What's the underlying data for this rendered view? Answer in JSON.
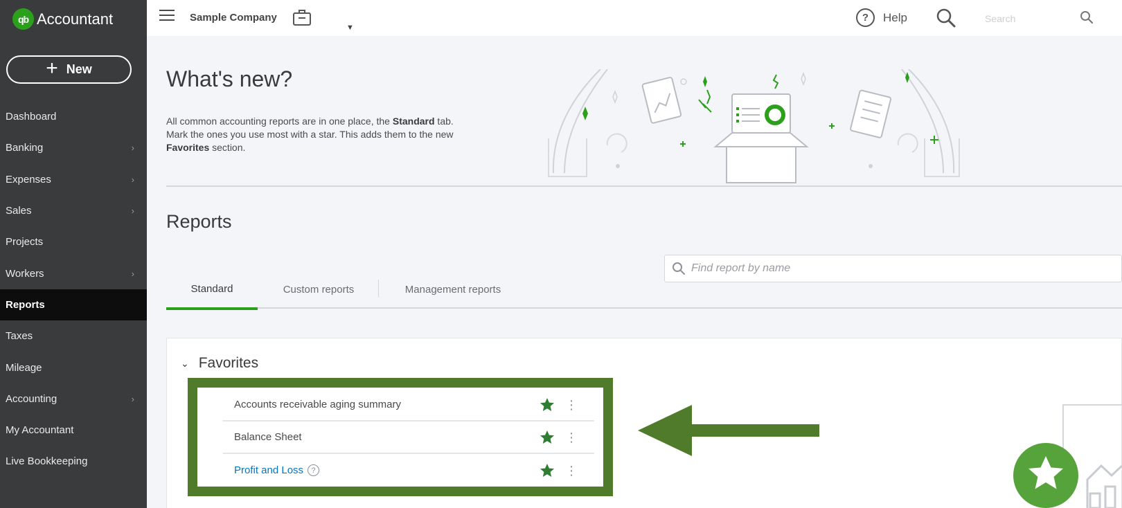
{
  "brand": {
    "logo_text": "qb",
    "name": "Accountant"
  },
  "sidebar": {
    "new_label": "New",
    "items": [
      {
        "label": "Dashboard",
        "chevron": false,
        "active": false
      },
      {
        "label": "Banking",
        "chevron": true,
        "active": false
      },
      {
        "label": "Expenses",
        "chevron": true,
        "active": false
      },
      {
        "label": "Sales",
        "chevron": true,
        "active": false
      },
      {
        "label": "Projects",
        "chevron": false,
        "active": false
      },
      {
        "label": "Workers",
        "chevron": true,
        "active": false
      },
      {
        "label": "Reports",
        "chevron": false,
        "active": true
      },
      {
        "label": "Taxes",
        "chevron": false,
        "active": false
      },
      {
        "label": "Mileage",
        "chevron": false,
        "active": false
      },
      {
        "label": "Accounting",
        "chevron": true,
        "active": false
      },
      {
        "label": "My Accountant",
        "chevron": false,
        "active": false
      },
      {
        "label": "Live Bookkeeping",
        "chevron": false,
        "active": false
      }
    ]
  },
  "topbar": {
    "company": "Sample Company",
    "help_label": "Help",
    "search_placeholder": "Search"
  },
  "whats_new": {
    "title": "What's new?",
    "desc_part1": "All common accounting reports are in one place, the ",
    "desc_bold1": "Standard",
    "desc_part2": " tab. Mark the ones you use most with a star. This adds them to the new ",
    "desc_bold2": "Favorites",
    "desc_part3": " section."
  },
  "reports": {
    "title": "Reports",
    "find_placeholder": "Find report by name",
    "tabs": [
      "Standard",
      "Custom reports",
      "Management reports"
    ],
    "active_tab": "Standard",
    "favorites_label": "Favorites",
    "favorites": [
      {
        "name": "Accounts receivable aging summary",
        "link": false,
        "info": false
      },
      {
        "name": "Balance Sheet",
        "link": false,
        "info": false
      },
      {
        "name": "Profit and Loss",
        "link": true,
        "info": true
      }
    ]
  },
  "colors": {
    "sidebar_bg": "#3a3b3d",
    "brand_green": "#2ca01c",
    "highlight_green": "#4f7b2a",
    "star_green": "#2e7d32",
    "link_blue": "#0077c5"
  }
}
